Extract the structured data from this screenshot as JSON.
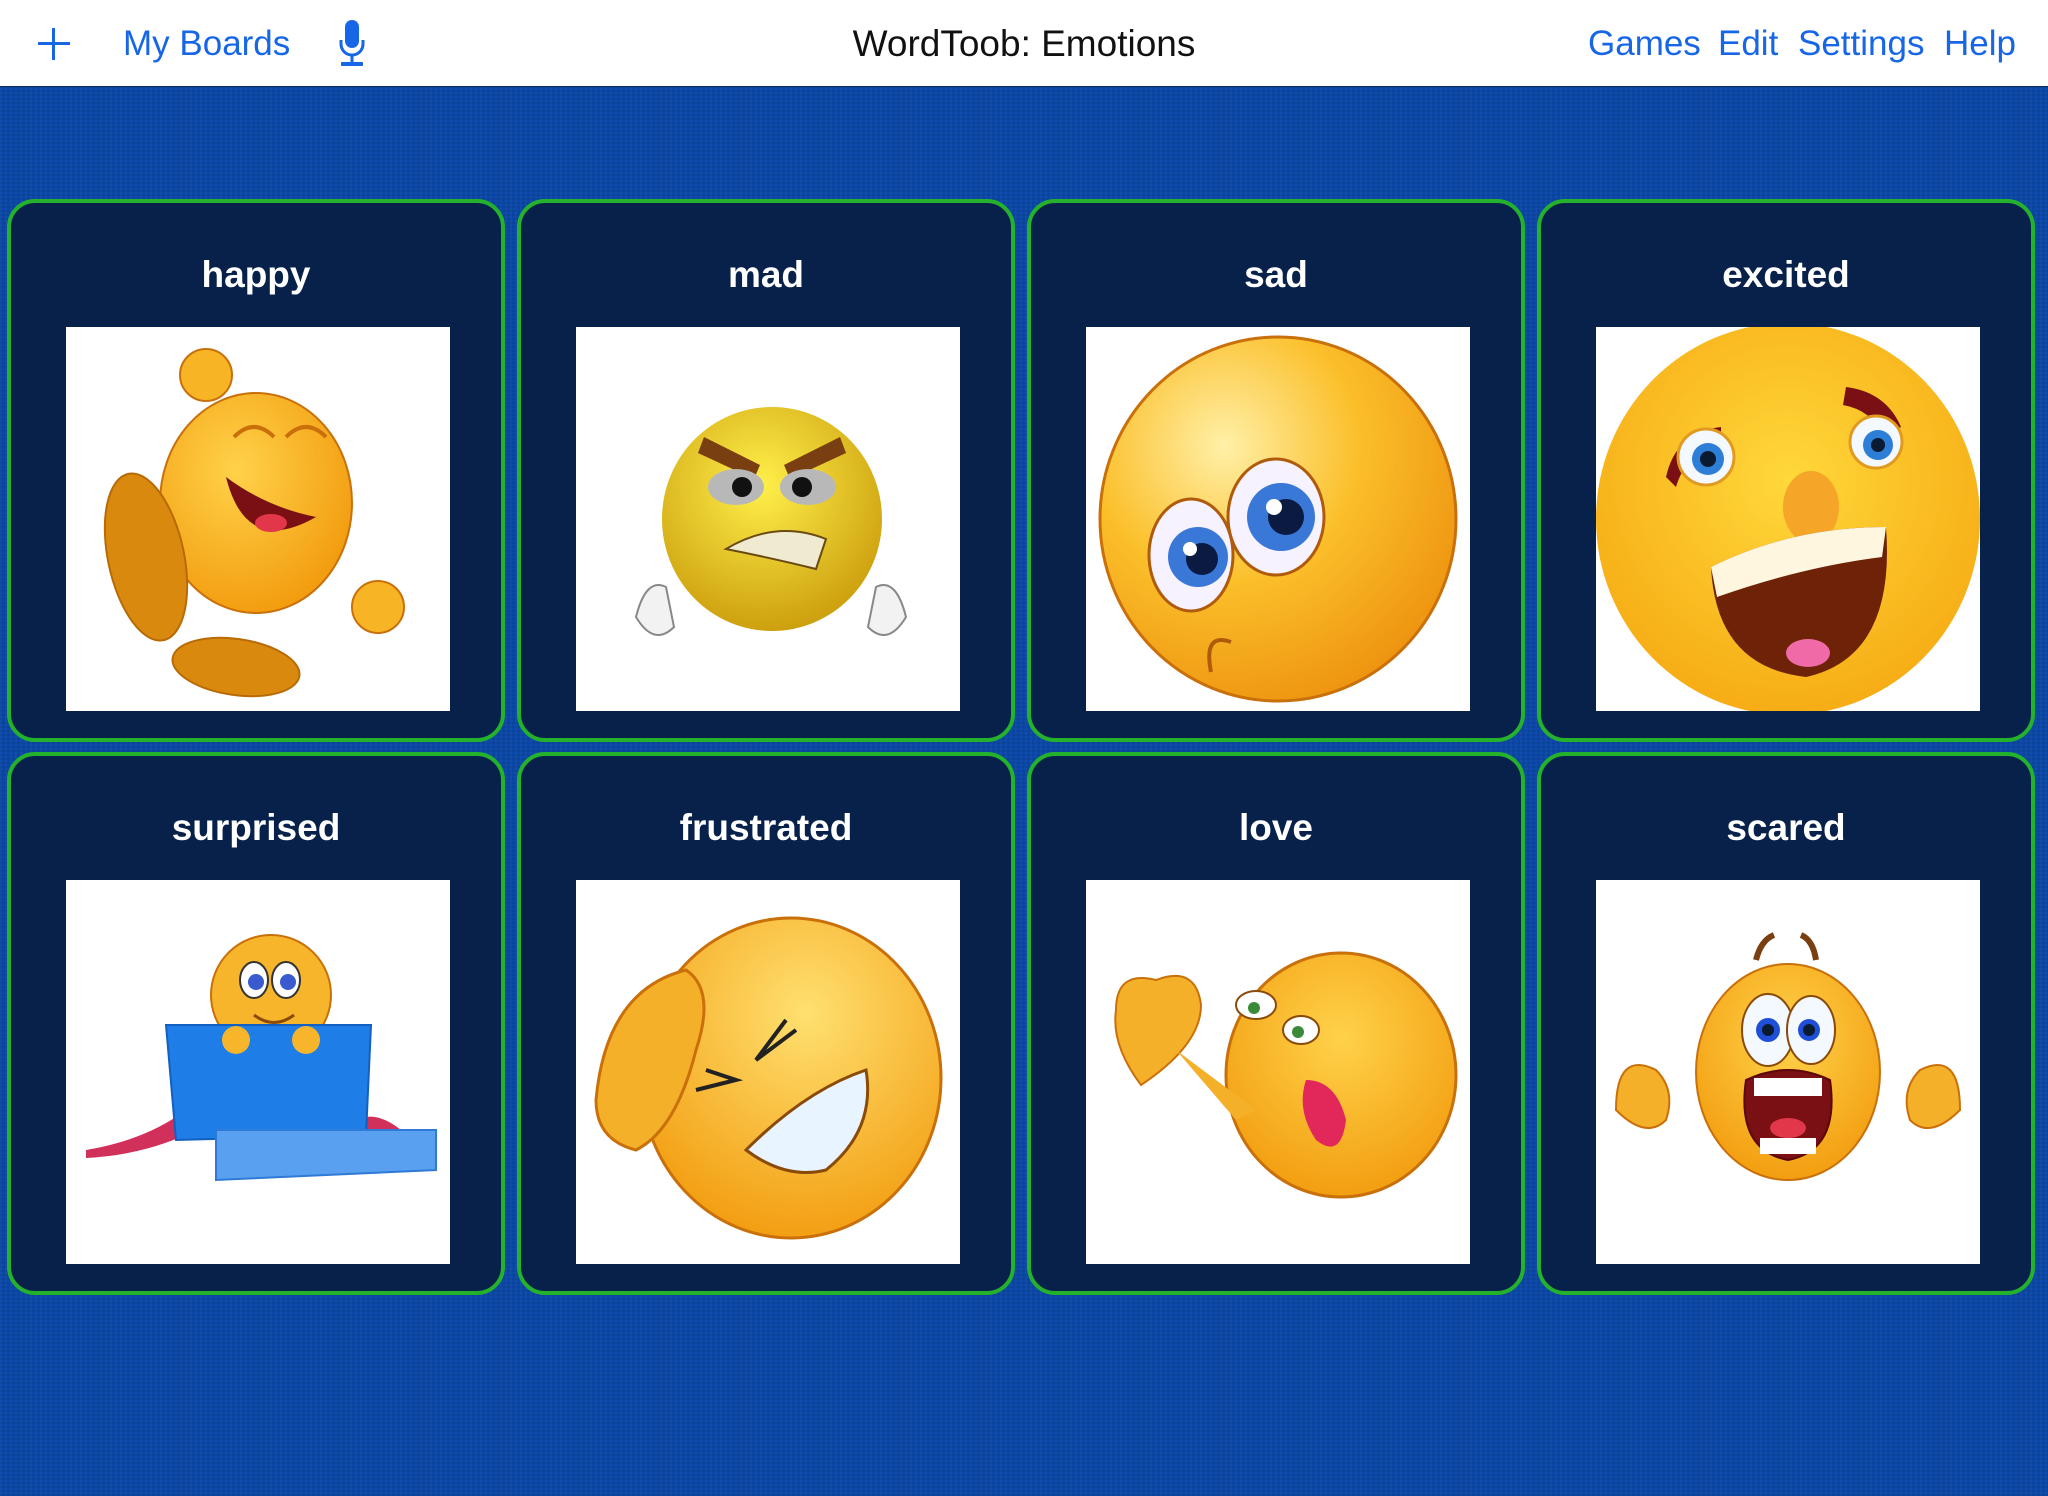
{
  "navbar": {
    "add_icon": "plus-icon",
    "my_boards_label": "My Boards",
    "mic_icon": "microphone-icon",
    "title": "WordToob: Emotions",
    "right_links": [
      "Games",
      "Edit",
      "Settings",
      "Help"
    ],
    "link_color": "#1766e6"
  },
  "board": {
    "border_color": "#24b22c",
    "tile_background": "#07214b",
    "page_background": "#0a47a6",
    "tiles": [
      {
        "label": "happy",
        "image": "laughing-emoji"
      },
      {
        "label": "mad",
        "image": "angry-emoji-with-fists"
      },
      {
        "label": "sad",
        "image": "sad-teary-emoji"
      },
      {
        "label": "excited",
        "image": "excited-open-mouth-emoji"
      },
      {
        "label": "surprised",
        "image": "emoji-in-gift-box"
      },
      {
        "label": "frustrated",
        "image": "frustrated-emoji-hand-on-head"
      },
      {
        "label": "love",
        "image": "emoji-blowing-heart-kiss"
      },
      {
        "label": "scared",
        "image": "screaming-scared-emoji"
      }
    ]
  }
}
